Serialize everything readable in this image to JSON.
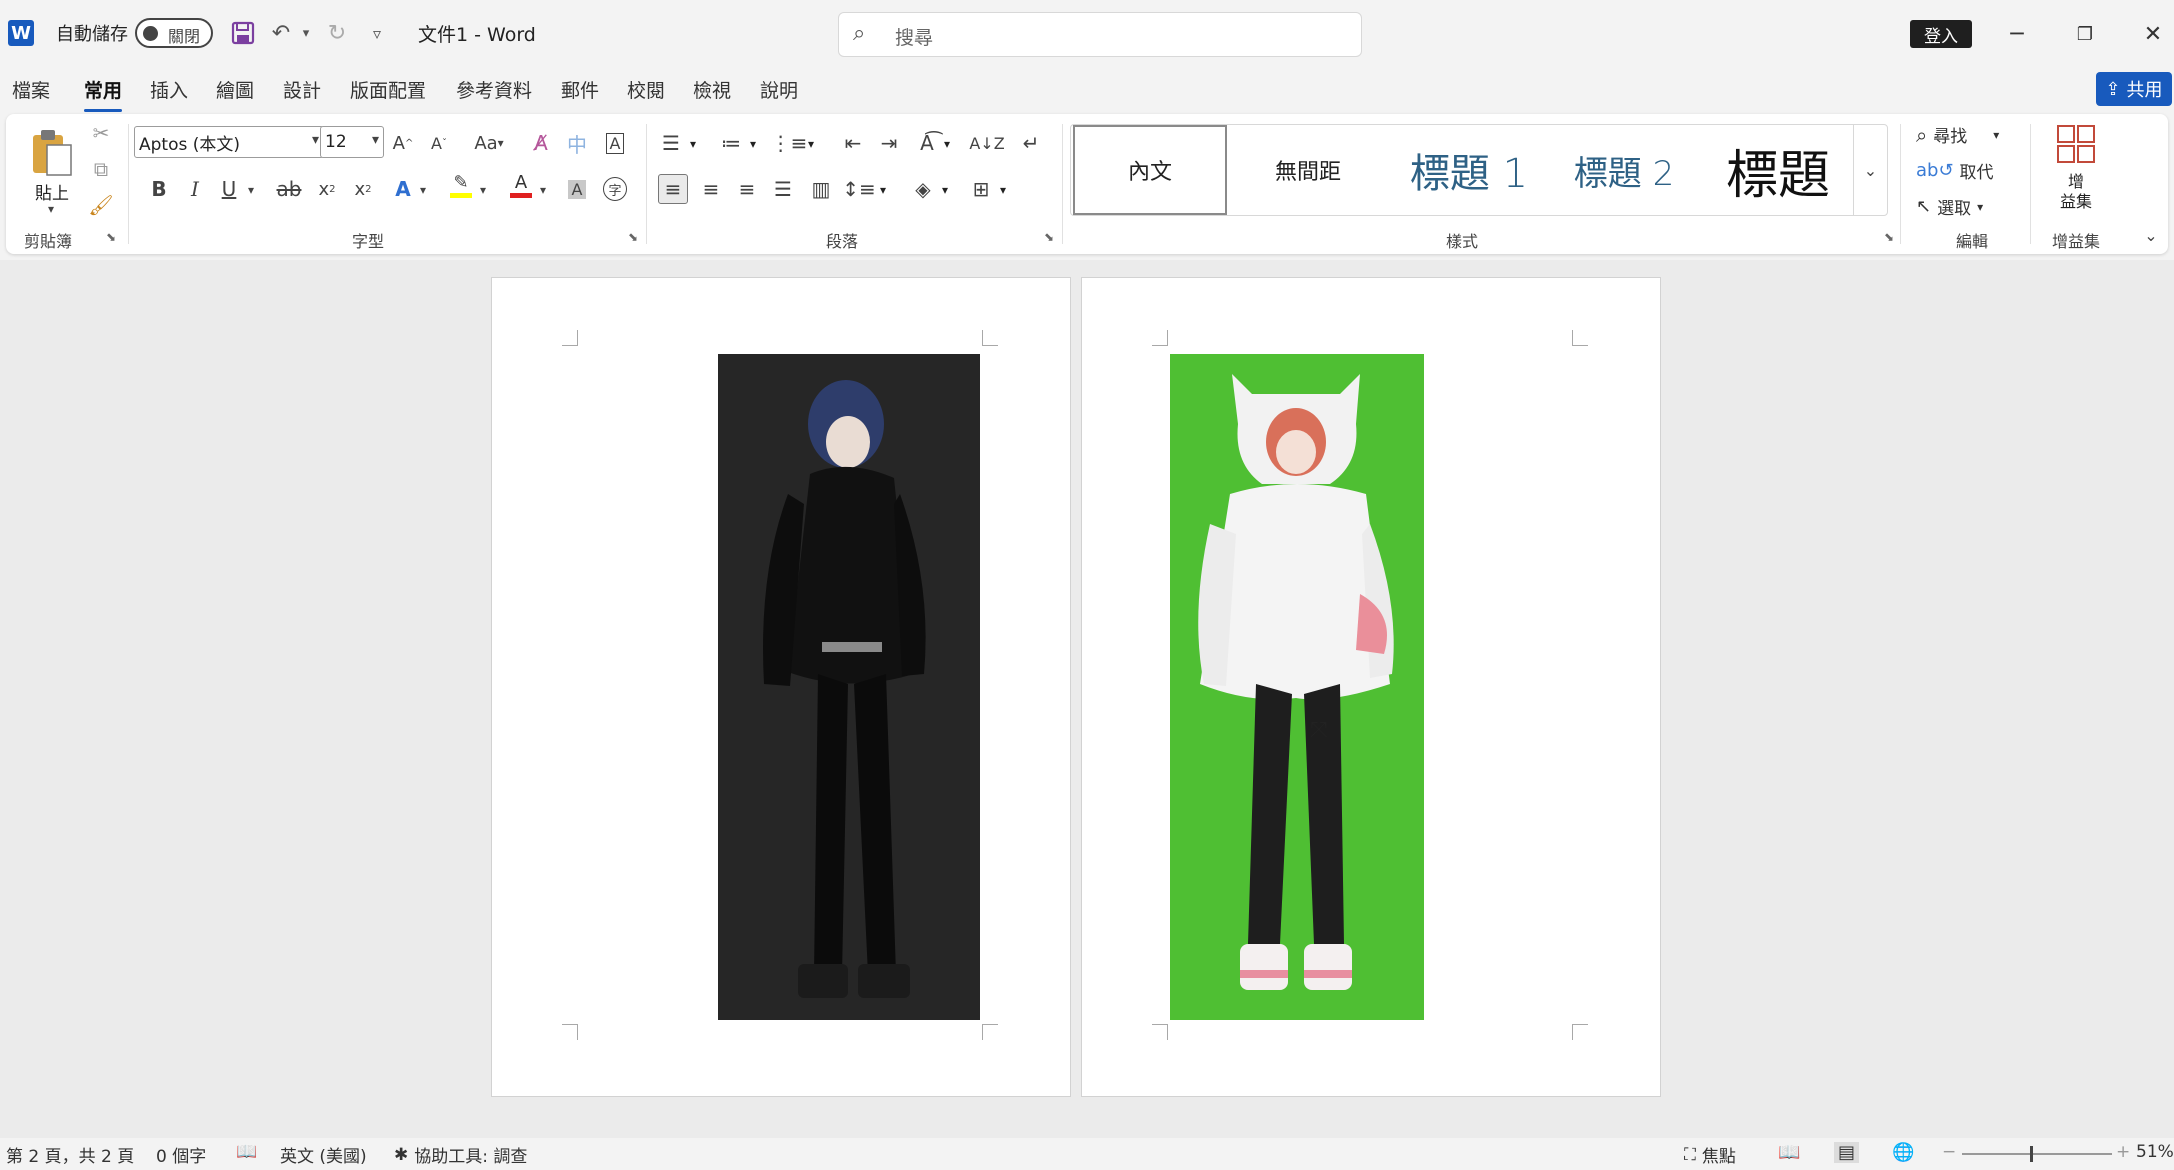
{
  "titlebar": {
    "app_logo": "W",
    "autosave_label": "自動儲存",
    "autosave_state": "關閉",
    "doc_title": "文件1  -  Word",
    "search_placeholder": "搜尋",
    "signin_label": "登入",
    "icons": [
      "save-icon",
      "undo-icon",
      "redo-icon",
      "customize-qat-icon",
      "minimize-icon",
      "restore-icon",
      "close-icon"
    ]
  },
  "tabs": [
    "檔案",
    "常用",
    "插入",
    "繪圖",
    "設計",
    "版面配置",
    "參考資料",
    "郵件",
    "校閱",
    "檢視",
    "說明"
  ],
  "active_tab": "常用",
  "share_label": "共用",
  "ribbon": {
    "clipboard": {
      "paste_label": "貼上",
      "group_label": "剪貼簿"
    },
    "font": {
      "font_name": "Aptos (本文)",
      "font_size": "12",
      "group_label": "字型",
      "case_label": "Aa"
    },
    "paragraph": {
      "group_label": "段落"
    },
    "styles": {
      "items": [
        "內文",
        "無間距",
        "標題 1",
        "標題 2",
        "標題"
      ],
      "selected": "內文",
      "group_label": "樣式"
    },
    "editing": {
      "find_label": "尋找",
      "replace_label": "取代",
      "select_label": "選取",
      "group_label": "編輯"
    },
    "addins": {
      "label": "增\n益集",
      "group_label": "增益集"
    }
  },
  "colors": {
    "accent": "#185abd",
    "highlight": "#ffff00",
    "font_color": "#e02020",
    "green_background": "#4fbf33"
  },
  "statusbar": {
    "page_info": "第 2 頁，共 2 頁",
    "word_count": "0 個字",
    "language": "英文 (美國)",
    "accessibility": "協助工具: 調查",
    "focus_label": "焦點",
    "zoom": "51%"
  }
}
